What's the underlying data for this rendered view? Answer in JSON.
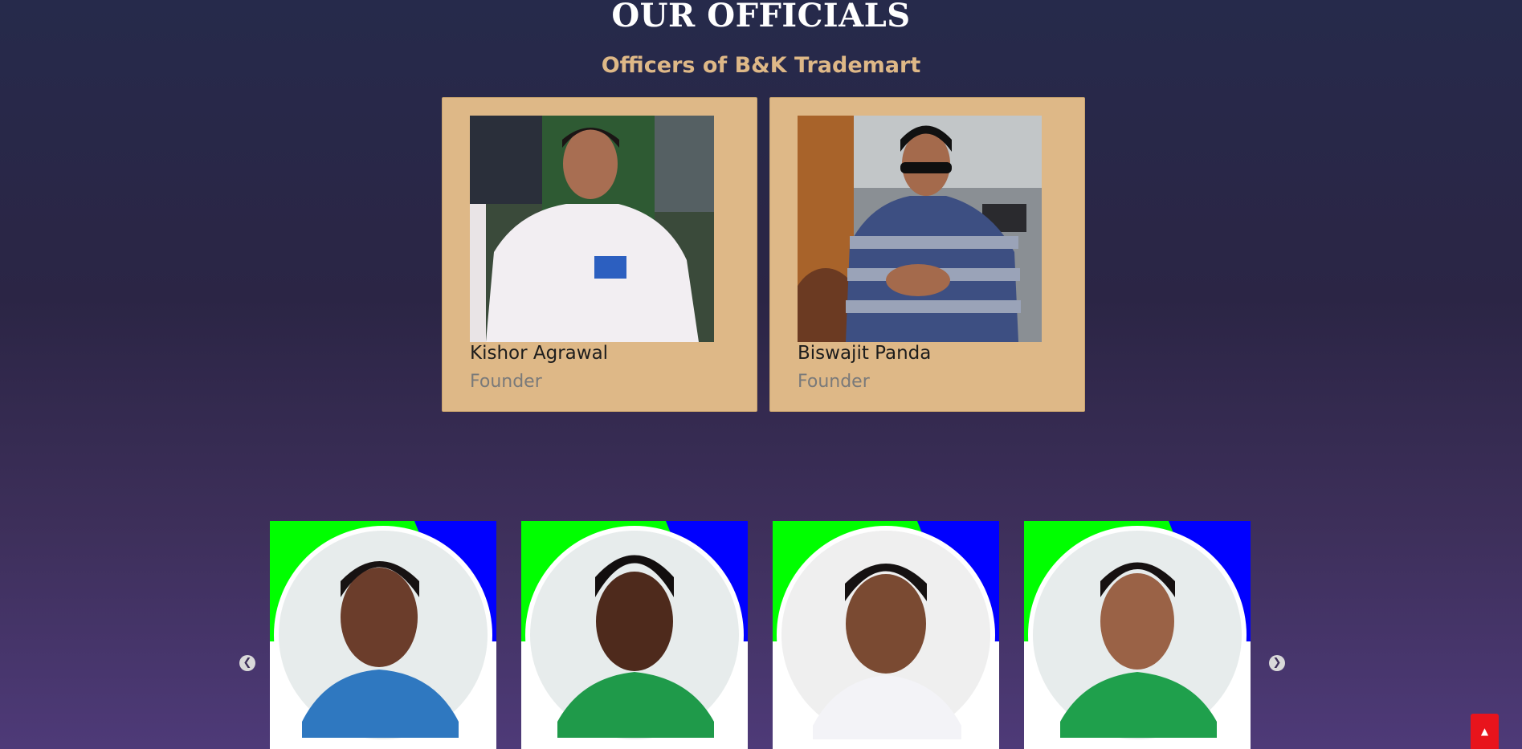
{
  "section": {
    "title": "OUR OFFICIALS",
    "subtitle": "Officers of B&K Trademart"
  },
  "officials": [
    {
      "name": "Kishor Agrawal",
      "role": "Founder"
    },
    {
      "name": "Biswajit Panda",
      "role": "Founder"
    }
  ],
  "carousel": {
    "prev_icon": "chevron-left-icon",
    "next_icon": "chevron-right-icon",
    "slides": 4
  },
  "scroll_top": {
    "icon": "caret-up-icon",
    "label": "▲"
  },
  "colors": {
    "accent": "#deb887",
    "slide_green": "#00ff00",
    "slide_blue": "#0000ff",
    "scroll_top": "#e8141c"
  }
}
